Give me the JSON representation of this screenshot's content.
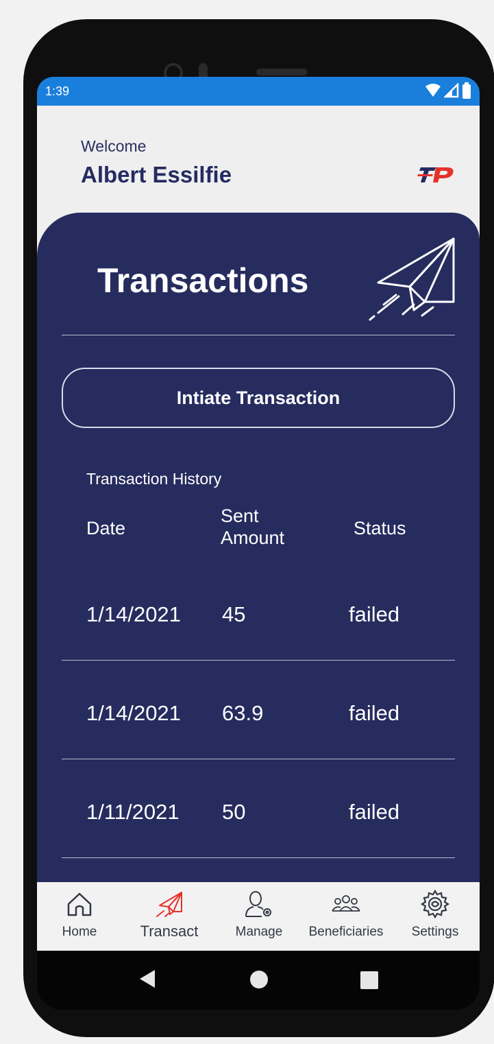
{
  "status_bar": {
    "time": "1:39"
  },
  "header": {
    "welcome": "Welcome",
    "user_name": "Albert Essilfie"
  },
  "panel": {
    "title": "Transactions",
    "initiate_button": "Intiate Transaction",
    "history_label": "Transaction History",
    "columns": {
      "date": "Date",
      "amount_line1": "Sent",
      "amount_line2": "Amount",
      "status": "Status"
    },
    "rows": [
      {
        "date": "1/14/2021",
        "amount": "45",
        "status": "failed"
      },
      {
        "date": "1/14/2021",
        "amount": "63.9",
        "status": "failed"
      },
      {
        "date": "1/11/2021",
        "amount": "50",
        "status": "failed"
      }
    ]
  },
  "bottom_nav": {
    "items": [
      {
        "label": "Home",
        "icon": "home-icon"
      },
      {
        "label": "Transact",
        "icon": "paper-plane-icon"
      },
      {
        "label": "Manage",
        "icon": "user-gear-icon"
      },
      {
        "label": "Beneficiaries",
        "icon": "group-icon"
      },
      {
        "label": "Settings",
        "icon": "gear-icon"
      }
    ],
    "active": "Transact"
  },
  "colors": {
    "status_bar": "#1a7fdc",
    "panel": "#262c5e",
    "accent_red": "#e5332a",
    "brand_navy": "#252b62",
    "background": "#efefef"
  }
}
